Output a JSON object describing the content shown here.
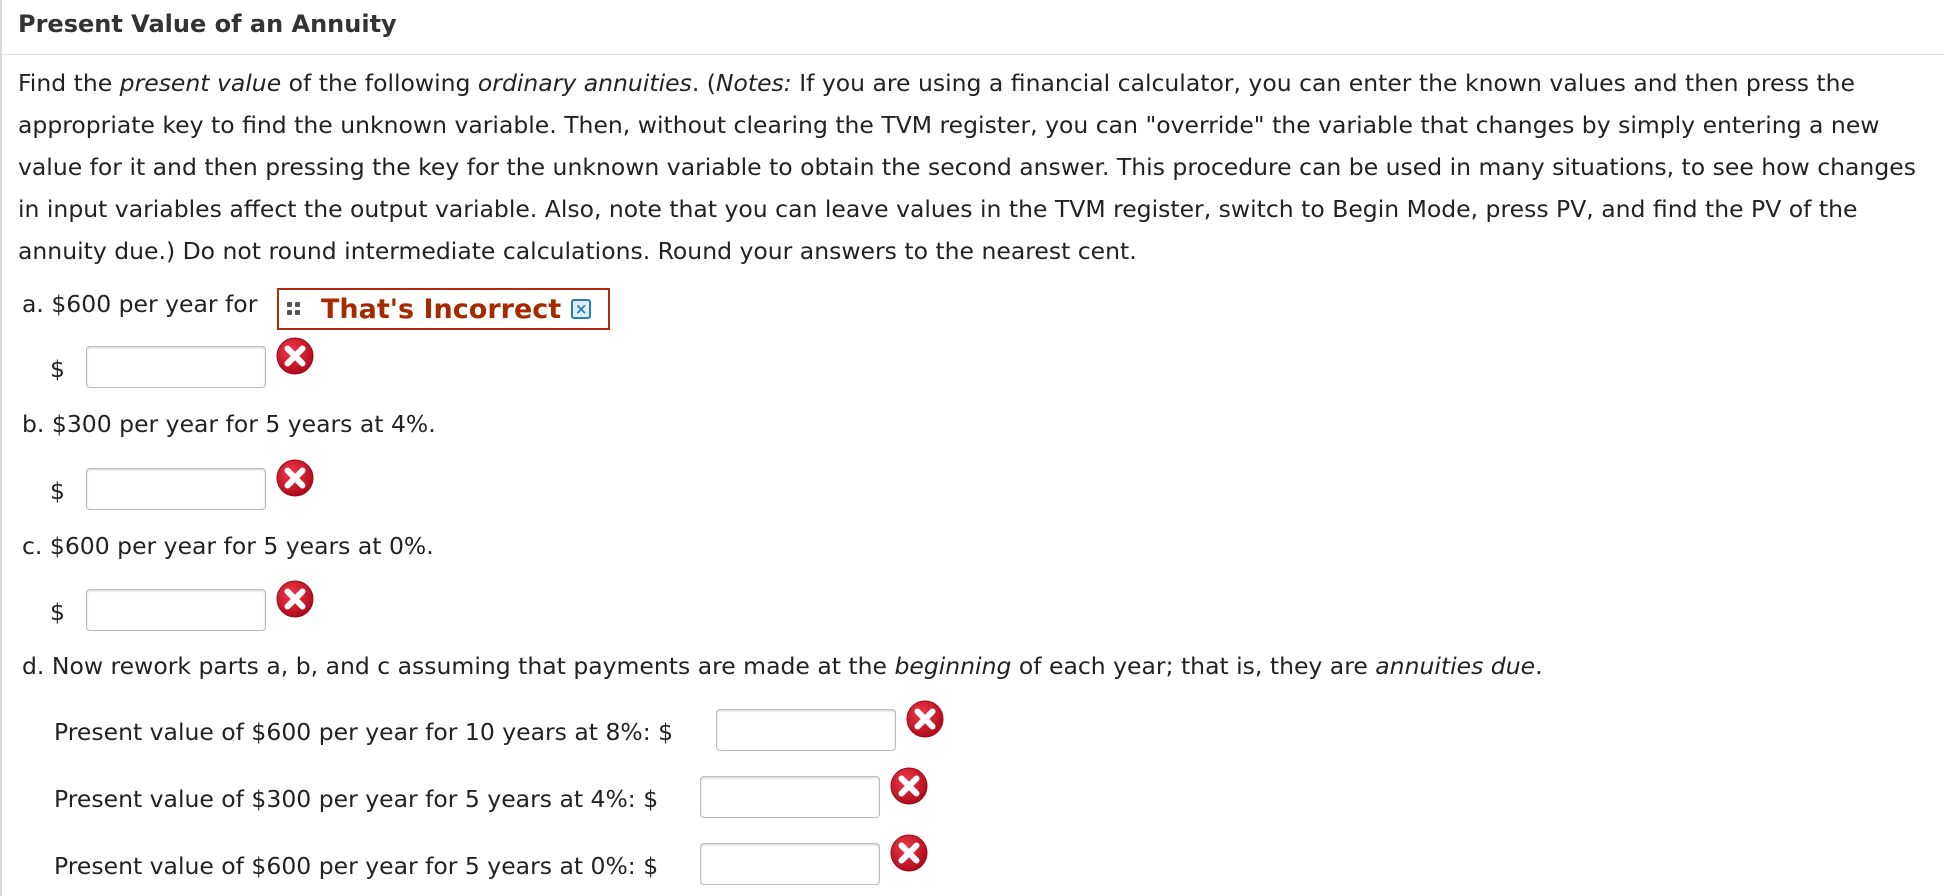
{
  "title": "Present Value of an Annuity",
  "instructions": {
    "p1": "Find the ",
    "em1": "present value",
    "p2": " of the following ",
    "em2": "ordinary annuities",
    "p3": ". (",
    "em3": "Notes:",
    "p4": " If you are using a financial calculator, you can enter the known values and then press the appropriate key to find the unknown variable. Then, without clearing the TVM register, you can \"override\" the variable that changes by simply entering a new value for it and then pressing the key for the unknown variable to obtain the second answer. This procedure can be used in many situations, to see how changes in input variables affect the output variable. Also, note that you can leave values in the TVM register, switch to Begin Mode, press PV, and find the PV of the annuity due.) Do not round intermediate calculations. Round your answers to the nearest cent."
  },
  "parts": {
    "a": {
      "letter": "a.",
      "text": "$600 per year for"
    },
    "b": {
      "letter": "b.",
      "text": "$300 per year for 5 years at 4%."
    },
    "c": {
      "letter": "c.",
      "text": "$600 per year for 5 years at 0%."
    },
    "d": {
      "letter": "d.",
      "t1": "Now rework parts a, b, and c assuming that payments are made at the ",
      "em1": "beginning",
      "t2": " of each year; that is, they are ",
      "em2": "annuities due",
      "t3": "."
    }
  },
  "feedback": {
    "text": "That's Incorrect",
    "close": "×"
  },
  "currency": "$",
  "due_rows": [
    "Present value of $600 per year for 10 years at 8%: $",
    "Present value of $300 per year for 5 years at 4%: $",
    "Present value of $600 per year for 5 years at 0%: $"
  ],
  "answers": {
    "a": "",
    "b": "",
    "c": "",
    "d1": "",
    "d2": "",
    "d3": ""
  },
  "icons": {
    "incorrect": "incorrect-x-icon",
    "drag": "drag-handle-icon",
    "close": "close-icon"
  },
  "colors": {
    "incorrect_red": "#c8102e",
    "feedback_border": "#b22b0e",
    "feedback_text": "#a52a00",
    "close_blue": "#2a7ab8"
  }
}
